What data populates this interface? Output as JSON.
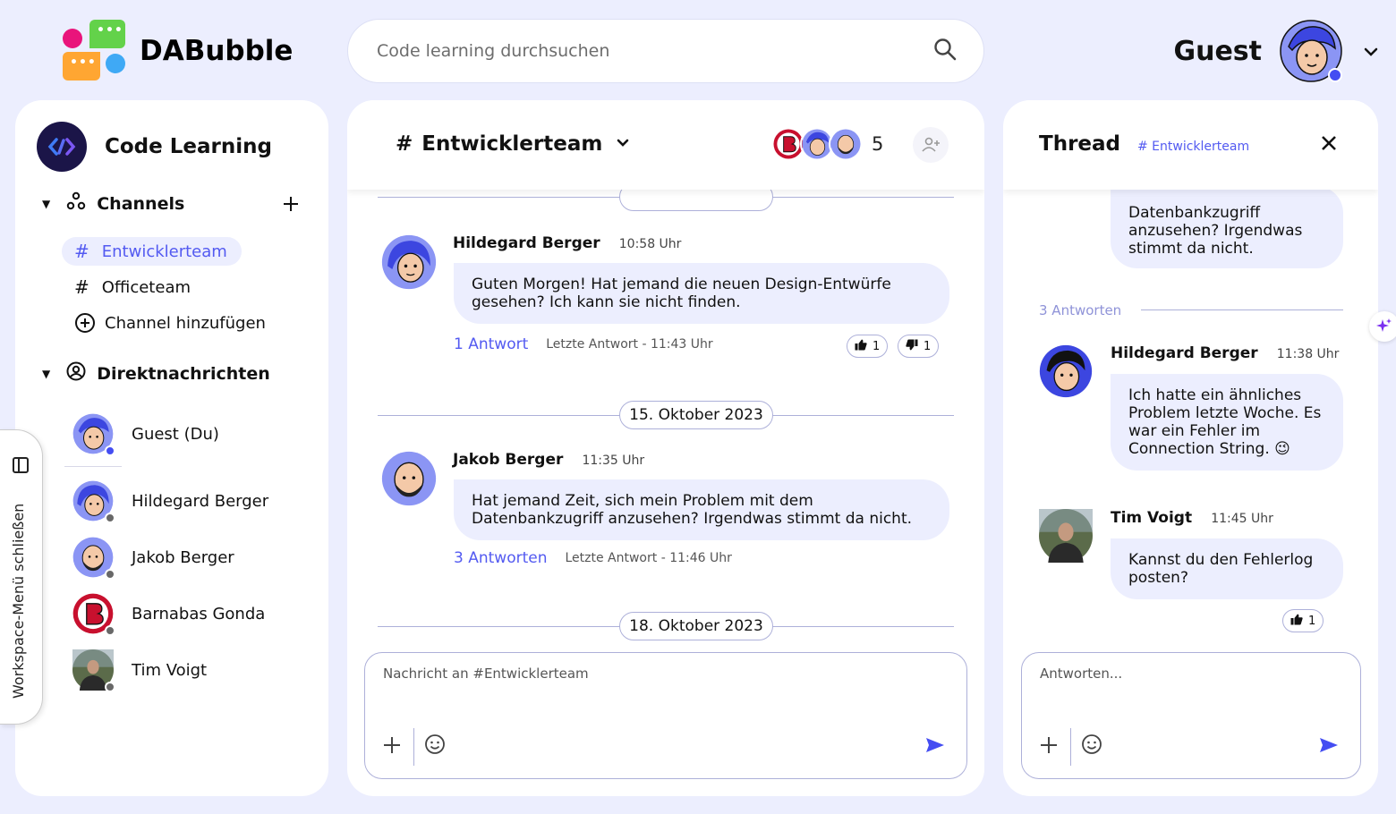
{
  "app": {
    "name": "DABubble"
  },
  "search": {
    "placeholder": "Code learning durchsuchen"
  },
  "user": {
    "name": "Guest"
  },
  "workspace": {
    "name": "Code Learning",
    "channels_label": "Channels",
    "channels": [
      {
        "label": "Entwicklerteam",
        "active": true
      },
      {
        "label": "Officeteam",
        "active": false
      }
    ],
    "add_channel_label": "Channel hinzufügen",
    "dm_label": "Direktnachrichten",
    "dms": [
      {
        "name": "Guest (Du)",
        "online": true
      },
      {
        "name": "Hildegard Berger",
        "online": false
      },
      {
        "name": "Jakob Berger",
        "online": false
      },
      {
        "name": "Barnabas Gonda",
        "online": false
      },
      {
        "name": "Tim Voigt",
        "online": false
      }
    ],
    "toggle_label": "Workspace-Menü schließen"
  },
  "channel": {
    "name": "Entwicklerteam",
    "member_count": "5",
    "messages": [
      {
        "author": "Hildegard Berger",
        "time": "10:58 Uhr",
        "text": "Guten Morgen! Hat jemand die neuen Design-Entwürfe gesehen? Ich kann sie nicht finden.",
        "replies": "1 Antwort",
        "last_reply": "Letzte Antwort - 11:43 Uhr",
        "reactions": [
          {
            "type": "thumbs-up",
            "count": "1"
          },
          {
            "type": "thumbs-down",
            "count": "1"
          }
        ]
      },
      {
        "author": "Jakob Berger",
        "time": "11:35 Uhr",
        "text": "Hat jemand Zeit, sich mein Problem mit dem Datenbankzugriff anzusehen? Irgendwas stimmt da nicht.",
        "replies": "3 Antworten",
        "last_reply": "Letzte Antwort - 11:46 Uhr"
      }
    ],
    "dates": [
      "15. Oktober 2023",
      "18. Oktober 2023"
    ],
    "composer_placeholder": "Nachricht an #Entwicklerteam"
  },
  "thread": {
    "title": "Thread",
    "channel": "# Entwicklerteam",
    "parent_excerpt": "Datenbankzugriff anzusehen? Irgendwas stimmt da nicht.",
    "answers_label": "3 Antworten",
    "replies": [
      {
        "author": "Hildegard Berger",
        "time": "11:38 Uhr",
        "text": "Ich hatte ein ähnliches Problem letzte Woche. Es war ein Fehler im Connection String. 😉"
      },
      {
        "author": "Tim Voigt",
        "time": "11:45 Uhr",
        "text": "Kannst du den Fehlerlog posten?",
        "reaction_count": "1"
      }
    ],
    "composer_placeholder": "Antworten..."
  },
  "colors": {
    "accent": "#444df2",
    "bubble": "#eceefe",
    "background": "#eceefe"
  }
}
